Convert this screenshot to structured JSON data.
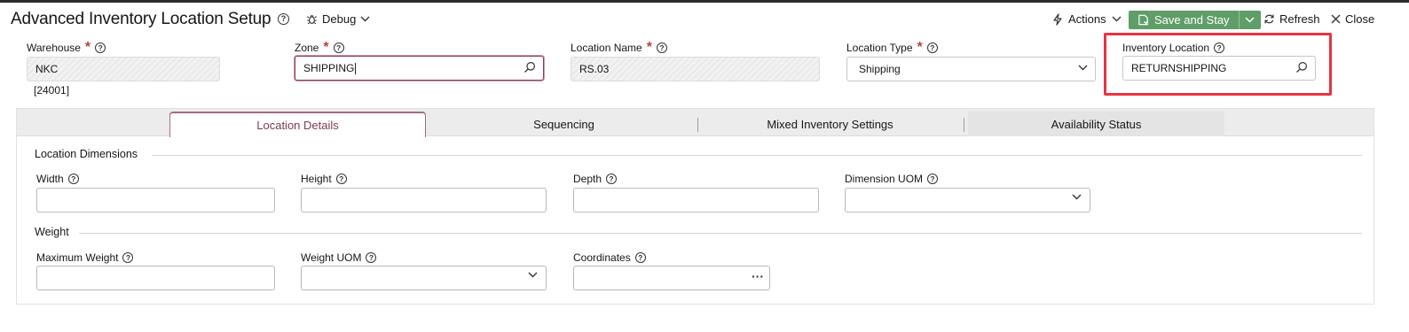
{
  "header": {
    "title": "Advanced Inventory Location Setup",
    "debug_label": "Debug",
    "actions_label": "Actions",
    "save_label": "Save and Stay",
    "refresh_label": "Refresh",
    "close_label": "Close"
  },
  "fields": {
    "warehouse": {
      "label": "Warehouse",
      "value": "NKC",
      "subtext": "[24001]"
    },
    "zone": {
      "label": "Zone",
      "value": "SHIPPING"
    },
    "location_name": {
      "label": "Location Name",
      "value": "RS.03"
    },
    "location_type": {
      "label": "Location Type",
      "value": "Shipping"
    },
    "inventory_location": {
      "label": "Inventory Location",
      "value": "RETURNSHIPPING"
    }
  },
  "tabs": [
    {
      "label": "Location Details"
    },
    {
      "label": "Sequencing"
    },
    {
      "label": "Mixed Inventory Settings"
    },
    {
      "label": "Availability Status"
    }
  ],
  "location_details": {
    "dimensions_title": "Location Dimensions",
    "width_label": "Width",
    "height_label": "Height",
    "depth_label": "Depth",
    "dimension_uom_label": "Dimension UOM",
    "weight_title": "Weight",
    "max_weight_label": "Maximum Weight",
    "weight_uom_label": "Weight UOM",
    "coordinates_label": "Coordinates"
  },
  "colors": {
    "accent": "#7a3a56",
    "save_button": "#5f9e68",
    "required": "#b0453c",
    "highlight": "#e8323f"
  }
}
